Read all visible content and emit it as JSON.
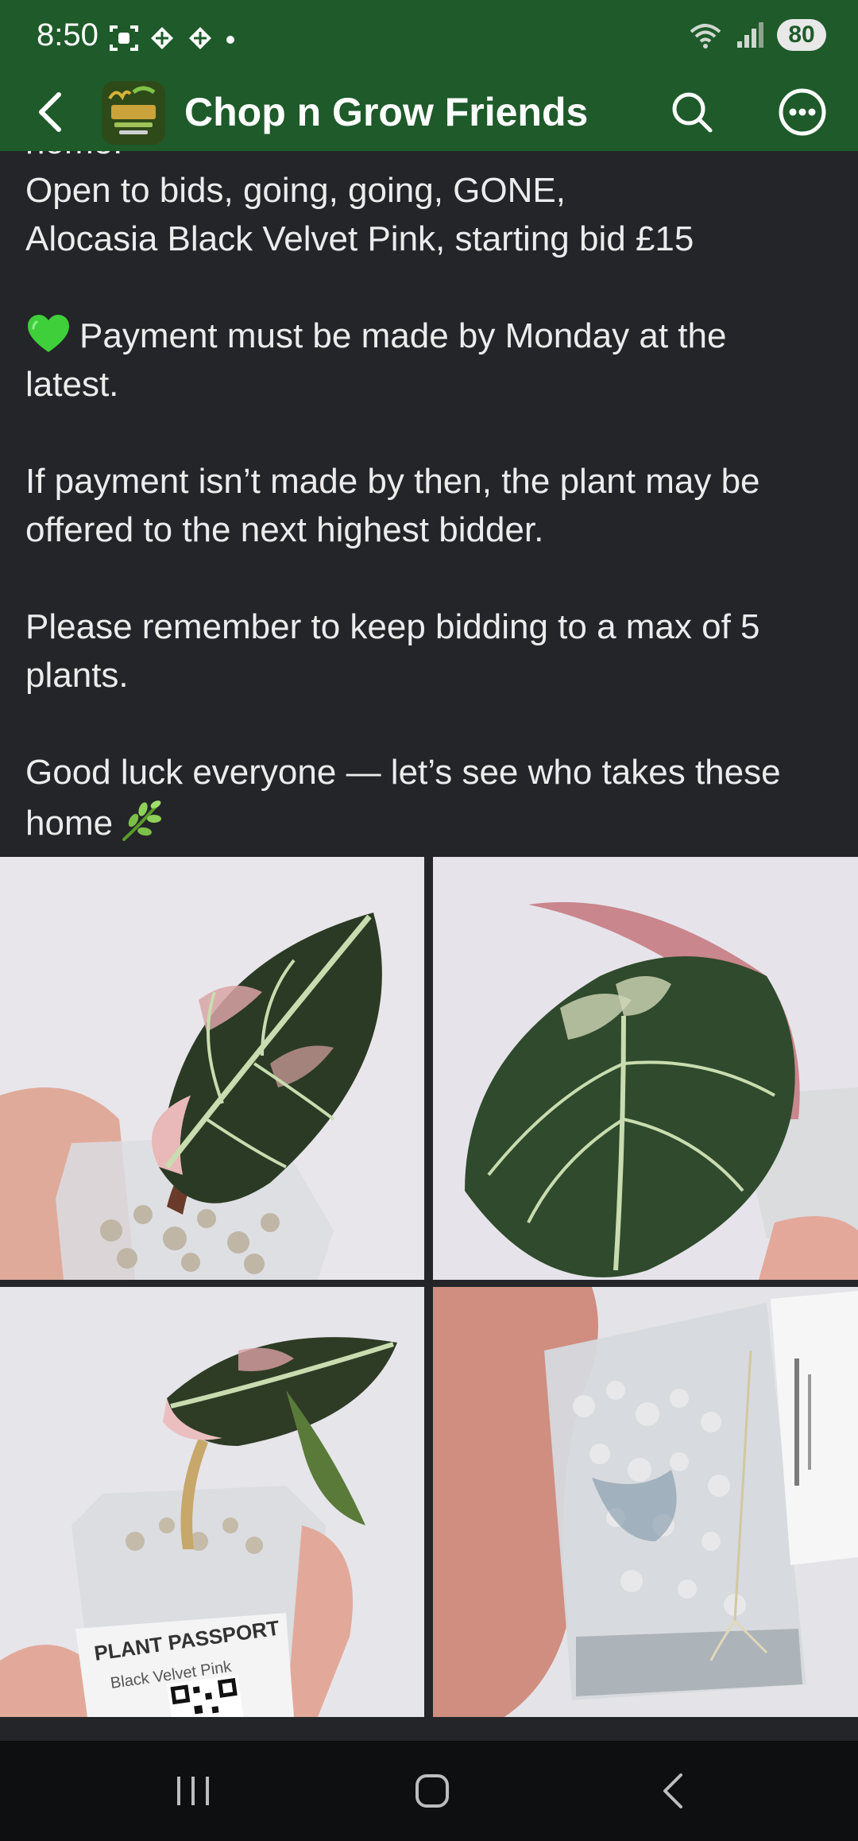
{
  "status_bar": {
    "time": "8:50",
    "battery": "80"
  },
  "header": {
    "title": "Chop n Grow Friends"
  },
  "post": {
    "paragraphs": [
      {
        "lines": [
          "home.",
          "Open to bids, going, going, GONE,",
          "Alocasia Black Velvet Pink, starting bid £15"
        ]
      },
      {
        "lines": [
          "Payment must be made by Monday at the",
          "latest."
        ]
      },
      {
        "lines": [
          "If payment isn’t made by then, the plant may be",
          "offered to the next highest bidder."
        ]
      },
      {
        "lines": [
          "Please remember to keep bidding to a max of 5",
          "plants."
        ]
      },
      {
        "lines": [
          "Good luck everyone — let’s see who takes these",
          "home"
        ]
      }
    ]
  },
  "photos": {
    "tag_lines": [
      "PLANT PASSPORT",
      "Black Velvet Pink"
    ]
  },
  "icons": {
    "back": "chevron-left-icon",
    "search": "search-icon",
    "more": "more-options-icon",
    "heart": "green-heart-icon",
    "herb": "herb-icon"
  },
  "colors": {
    "header_bg": "#1e5a2a",
    "post_bg": "#242528",
    "nav_bar_bg": "#0e0f11"
  }
}
